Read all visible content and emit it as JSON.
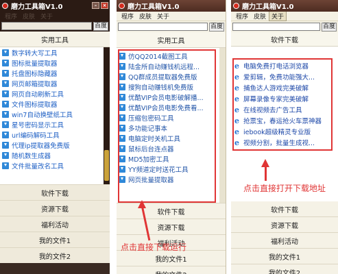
{
  "window_title": "磨力工具箱V1.0",
  "menu": [
    "程序",
    "皮肤",
    "关于"
  ],
  "search_button": "百度",
  "sections": {
    "tools": "实用工具",
    "downloads": "软件下载"
  },
  "window1_tools": [
    "数字转大写工具",
    "图标批量提取器",
    "托盘图标隐藏器",
    "网页邮箱提取器",
    "网页自动刷新工具",
    "文件图标提取器",
    "win7自动换壁纸工具",
    "星号密码显示工具",
    "url编码解码工具",
    "代理ip提取器免费版",
    "随机数生成器",
    "文件批量改名工具"
  ],
  "window2_tools": [
    "仿QQ2014截图工具",
    "陆金所自动赚钱机远程...",
    "QQ群成员提取器免费版",
    "搜狗自动赚钱机免费版",
    "优酷VIP会员电影破解播...",
    "优酷VIP会员电影免费看...",
    "压缩包密码工具",
    "多功能记事本",
    "电脑定时关机工具",
    "鼠标后台连点器",
    "MD5加密工具",
    "YY频道定时送花工具",
    "网页批量提取器"
  ],
  "window3_downloads": [
    "电脑免费打电话浏览器",
    "爱剪辑，免费功能强大...",
    "捕鱼达人游戏完美破解",
    "屏幕录像专家完美破解",
    "在线视频去广告工具",
    "抢票宝，春运抢火车票神器",
    "iebook超级精灵专业版",
    "视频分割，批量生成视..."
  ],
  "nav_buttons": [
    "软件下载",
    "资源下载",
    "福利活动",
    "我的文件1",
    "我的文件2"
  ],
  "annotations": {
    "run": "点击直接下载运行",
    "open": "点击直接打开下载地址"
  },
  "colors": {
    "accent_red": "#e03535",
    "link_blue": "#1d5fc4",
    "title_brown": "#4d2c21"
  }
}
